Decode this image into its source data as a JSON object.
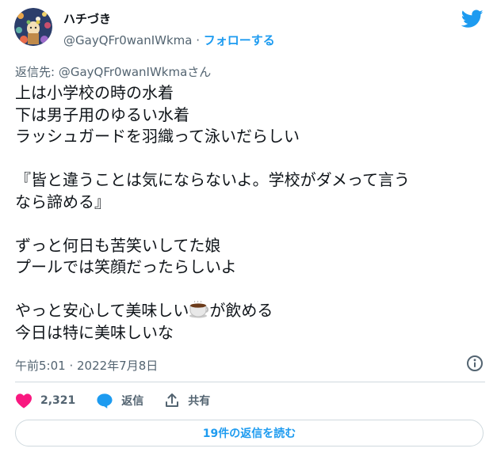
{
  "author": {
    "display_name": "ハチづき",
    "handle": "@GayQFr0wanIWkma",
    "separator": " · ",
    "follow_label": "フォローする"
  },
  "reply": {
    "prefix": "返信先: ",
    "handle": "@GayQFr0wanIWkma",
    "suffix": "さん"
  },
  "tweet": {
    "lines": [
      "上は小学校の時の水着",
      "下は男子用のゆるい水着",
      "ラッシュガードを羽織って泳いだらしい",
      "",
      "『皆と違うことは気にならないよ。学校がダメって言う",
      "なら諦める』",
      "",
      "ずっと何日も苦笑いしてた娘",
      "プールでは笑顔だったらしいよ",
      "",
      "やっと安心して美味しい",
      "今日は特に美味しいな"
    ],
    "line10_after_emoji": "が飲める",
    "emoji": "coffee-icon"
  },
  "meta": {
    "time": "午前5:01",
    "separator": " · ",
    "date": "2022年7月8日"
  },
  "actions": {
    "like_count": "2,321",
    "reply_label": "返信",
    "share_label": "共有"
  },
  "replies_button": "19件の返信を読む",
  "colors": {
    "accent": "#1d9bf0",
    "like": "#f91880",
    "muted": "#536471",
    "border": "#cfd9de"
  }
}
